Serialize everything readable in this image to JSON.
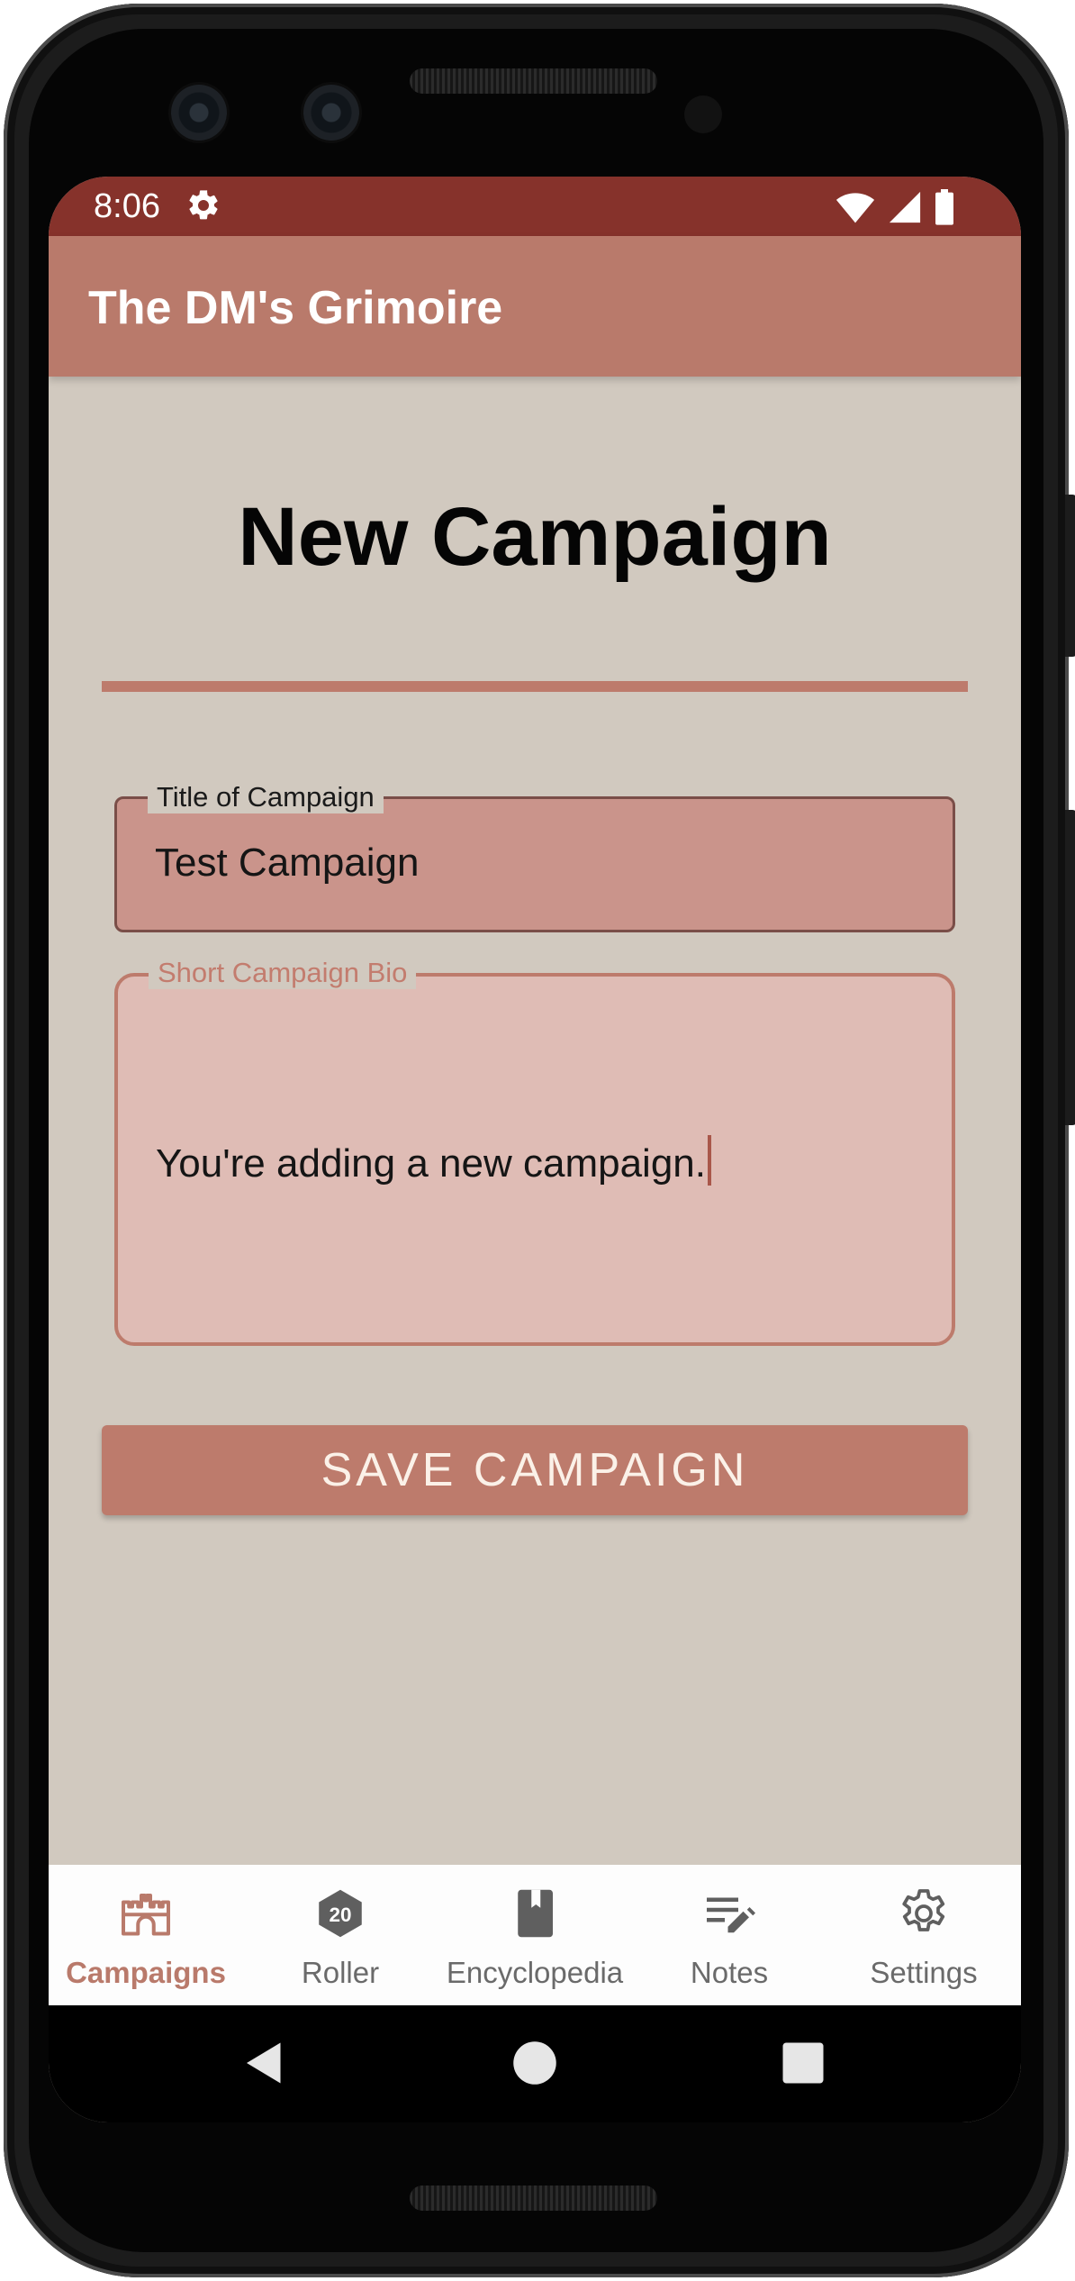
{
  "status_bar": {
    "time": "8:06",
    "icons": [
      "gear-icon",
      "wifi-icon",
      "cell-signal-icon",
      "battery-icon"
    ]
  },
  "app_bar": {
    "title": "The DM's Grimoire"
  },
  "page": {
    "title": "New Campaign"
  },
  "form": {
    "title_field": {
      "label": "Title of Campaign",
      "value": "Test Campaign"
    },
    "bio_field": {
      "label": "Short Campaign Bio",
      "value": "You're adding a new campaign."
    },
    "save_label": "SAVE CAMPAIGN"
  },
  "bottom_nav": {
    "items": [
      {
        "label": "Campaigns",
        "icon": "castle-icon",
        "active": true
      },
      {
        "label": "Roller",
        "icon": "d20-icon",
        "badge": "20",
        "active": false
      },
      {
        "label": "Encyclopedia",
        "icon": "book-icon",
        "active": false
      },
      {
        "label": "Notes",
        "icon": "notes-icon",
        "active": false
      },
      {
        "label": "Settings",
        "icon": "gear-icon",
        "active": false
      }
    ]
  },
  "theme": {
    "status_bar": "#86322b",
    "app_bar": "#b97a6b",
    "background": "#d1c9bf",
    "accent": "#bd7b6c",
    "title_field_fill": "#ca948b",
    "bio_field_fill": "#dfbcb5",
    "nav_active": "#b97a6b",
    "nav_inactive": "#6a6a6a"
  }
}
